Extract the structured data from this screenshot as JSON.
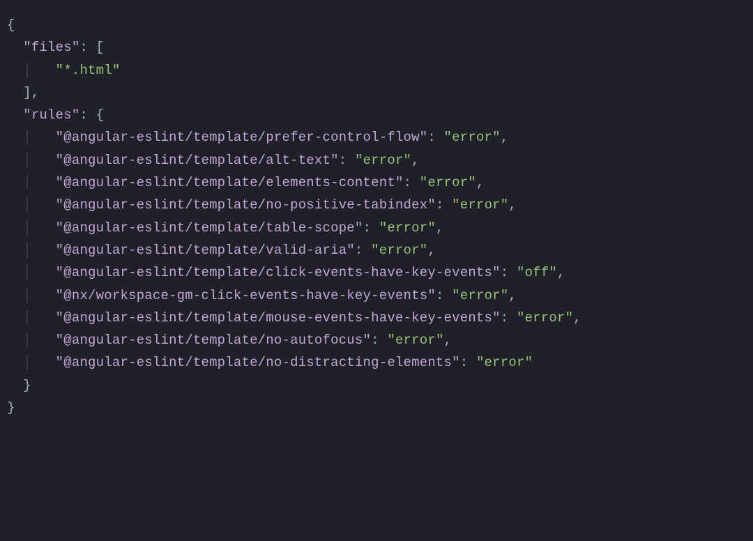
{
  "config": {
    "files_key": "\"files\"",
    "files_value": "\"*.html\"",
    "rules_key": "\"rules\"",
    "rules": [
      {
        "key": "\"@angular-eslint/template/prefer-control-flow\"",
        "value": "\"error\"",
        "comma": ","
      },
      {
        "key": "\"@angular-eslint/template/alt-text\"",
        "value": "\"error\"",
        "comma": ","
      },
      {
        "key": "\"@angular-eslint/template/elements-content\"",
        "value": "\"error\"",
        "comma": ","
      },
      {
        "key": "\"@angular-eslint/template/no-positive-tabindex\"",
        "value": "\"error\"",
        "comma": ","
      },
      {
        "key": "\"@angular-eslint/template/table-scope\"",
        "value": "\"error\"",
        "comma": ","
      },
      {
        "key": "\"@angular-eslint/template/valid-aria\"",
        "value": "\"error\"",
        "comma": ","
      },
      {
        "key": "\"@angular-eslint/template/click-events-have-key-events\"",
        "value": "\"off\"",
        "comma": ","
      },
      {
        "key": "\"@nx/workspace-gm-click-events-have-key-events\"",
        "value": "\"error\"",
        "comma": ","
      },
      {
        "key": "\"@angular-eslint/template/mouse-events-have-key-events\"",
        "value": "\"error\"",
        "comma": ","
      },
      {
        "key": "\"@angular-eslint/template/no-autofocus\"",
        "value": "\"error\"",
        "comma": ","
      },
      {
        "key": "\"@angular-eslint/template/no-distracting-elements\"",
        "value": "\"error\"",
        "comma": ""
      }
    ]
  },
  "punct": {
    "open_brace": "{",
    "close_brace": "}",
    "open_bracket": "[",
    "close_bracket_comma": "],",
    "colon_space": ": ",
    "comma": ","
  },
  "indent": {
    "l1": "  ",
    "l2_guide": "  │ ",
    "l3_guide": "  │   "
  }
}
